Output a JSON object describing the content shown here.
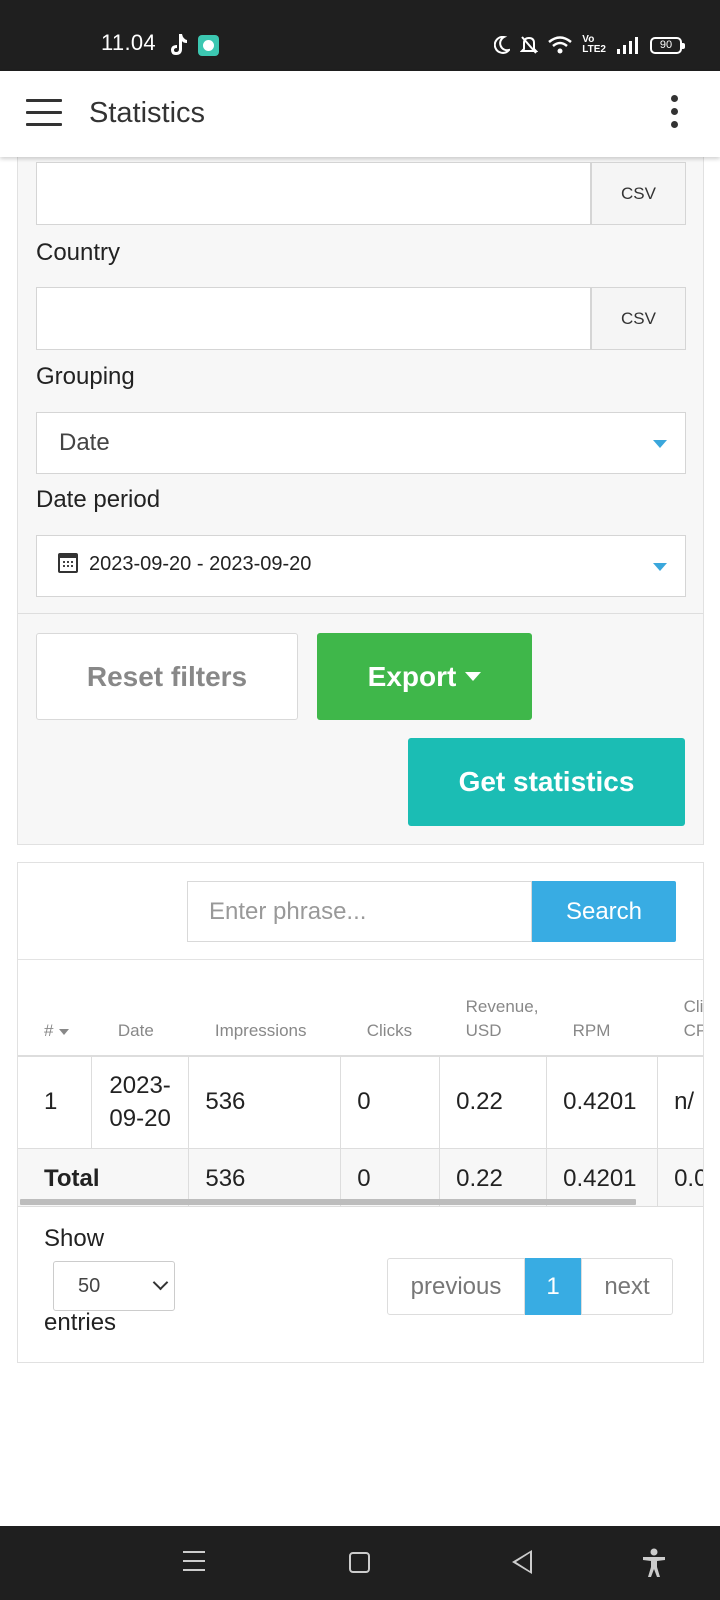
{
  "status_bar": {
    "time": "11.04",
    "battery": "90",
    "volte_top": "Vo",
    "volte_bottom": "LTE2"
  },
  "app_bar": {
    "title": "Statistics"
  },
  "filters": {
    "top_input": {
      "value": "",
      "csv_label": "CSV"
    },
    "country": {
      "label": "Country",
      "value": "",
      "csv_label": "CSV"
    },
    "grouping": {
      "label": "Grouping",
      "selected": "Date"
    },
    "date_period": {
      "label": "Date period",
      "value": "2023-09-20 - 2023-09-20"
    },
    "buttons": {
      "reset": "Reset filters",
      "export": "Export",
      "get_statistics": "Get statistics"
    }
  },
  "results": {
    "search": {
      "placeholder": "Enter phrase...",
      "button": "Search"
    },
    "table": {
      "columns": [
        "#",
        "Date",
        "Impressions",
        "Clicks",
        "Revenue, USD",
        "RPM",
        "Clicks CPM"
      ],
      "header_lines": {
        "hash": "#",
        "date": "Date",
        "impressions": "Impressions",
        "clicks": "Clicks",
        "revenue_1": "Revenue,",
        "revenue_2": "USD",
        "rpm": "RPM",
        "cpm_1": "Clic",
        "cpm_2": "CPI"
      },
      "rows": [
        {
          "num": "1",
          "date_1": "2023-",
          "date_2": "09-20",
          "impressions": "536",
          "clicks": "0",
          "revenue": "0.22",
          "rpm": "0.4201",
          "cpm": "n/"
        }
      ],
      "total": {
        "label": "Total",
        "impressions": "536",
        "clicks": "0",
        "revenue": "0.22",
        "rpm": "0.4201",
        "cpm": "0.0"
      }
    },
    "length": {
      "show": "Show",
      "value": "50",
      "entries": "entries"
    },
    "pagination": {
      "previous": "previous",
      "current": "1",
      "next": "next"
    }
  }
}
